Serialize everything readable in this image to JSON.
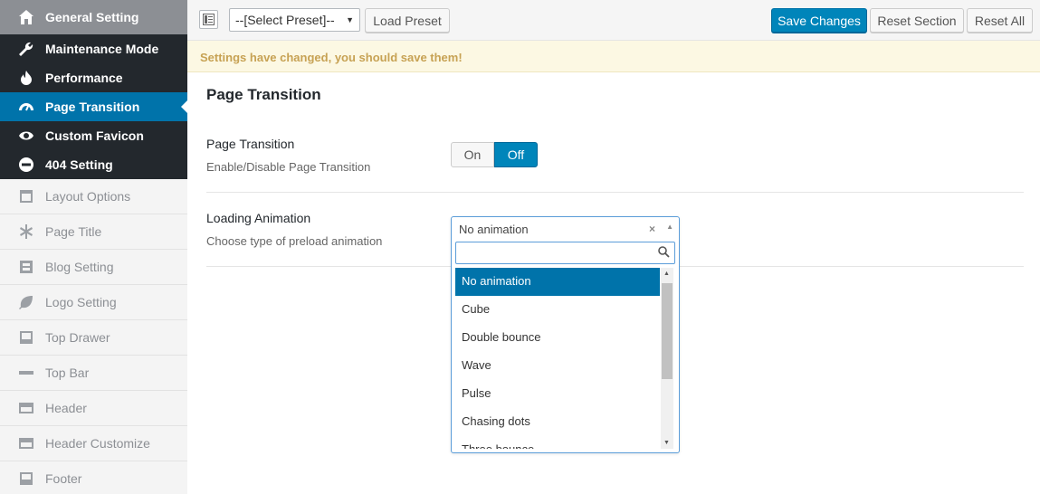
{
  "sidebar": {
    "items": [
      {
        "label": "General Setting",
        "icon": "home-icon"
      },
      {
        "label": "Maintenance Mode",
        "icon": "wrench-icon"
      },
      {
        "label": "Performance",
        "icon": "fire-icon"
      },
      {
        "label": "Page Transition",
        "icon": "dashboard-icon"
      },
      {
        "label": "Custom Favicon",
        "icon": "eye-icon"
      },
      {
        "label": "404 Setting",
        "icon": "minus-circle-icon"
      },
      {
        "label": "Layout Options",
        "icon": "layout-icon"
      },
      {
        "label": "Page Title",
        "icon": "asterisk-icon"
      },
      {
        "label": "Blog Setting",
        "icon": "blog-icon"
      },
      {
        "label": "Logo Setting",
        "icon": "leaf-icon"
      },
      {
        "label": "Top Drawer",
        "icon": "drawer-icon"
      },
      {
        "label": "Top Bar",
        "icon": "topbar-icon"
      },
      {
        "label": "Header",
        "icon": "header-icon"
      },
      {
        "label": "Header Customize",
        "icon": "header-customize-icon"
      },
      {
        "label": "Footer",
        "icon": "footer-icon"
      }
    ]
  },
  "toolbar": {
    "preset_value": "--[Select Preset]--",
    "load_preset": "Load Preset",
    "save_changes": "Save Changes",
    "reset_section": "Reset Section",
    "reset_all": "Reset All"
  },
  "notice": "Settings have changed, you should save them!",
  "section": {
    "title": "Page Transition",
    "fields": [
      {
        "title": "Page Transition",
        "subtitle": "Enable/Disable Page Transition",
        "on_label": "On",
        "off_label": "Off",
        "value": "Off"
      },
      {
        "title": "Loading Animation",
        "subtitle": "Choose type of preload animation",
        "selected": "No animation",
        "search_value": ""
      }
    ]
  },
  "dropdown": {
    "options": [
      "No animation",
      "Cube",
      "Double bounce",
      "Wave",
      "Pulse",
      "Chasing dots",
      "Three bounce"
    ]
  },
  "colors": {
    "accent": "#0073aa",
    "sidebar_dark": "#23282d",
    "notice_text": "#c7a254"
  }
}
